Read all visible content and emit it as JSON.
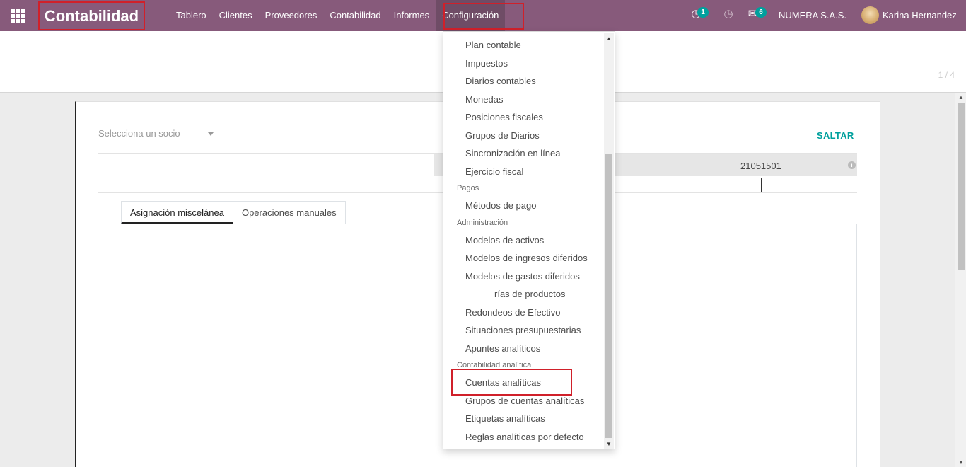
{
  "navbar": {
    "app_title": "Contabilidad",
    "menu": [
      "Tablero",
      "Clientes",
      "Proveedores",
      "Contabilidad",
      "Informes",
      "Configuración"
    ],
    "activity_count": "1",
    "messages_count": "6",
    "company": "NUMERA S.A.S.",
    "user": "Karina Hernandez",
    "colors": {
      "bar": "#875a7b",
      "active": "#6f4c66",
      "badge": "#00a09d",
      "highlight": "#d0202a"
    }
  },
  "control_panel": {
    "pager": "1 / 4"
  },
  "form": {
    "partner_placeholder": "Selecciona un socio",
    "skip_label": "SALTAR",
    "account_number": "21051501",
    "tabs": [
      "Asignación miscelánea",
      "Operaciones manuales"
    ]
  },
  "dropdown": {
    "items_top": [
      "Plan contable",
      "Impuestos",
      "Diarios contables",
      "Monedas",
      "Posiciones fiscales",
      "Grupos de Diarios",
      "Sincronización en línea",
      "Ejercicio fiscal"
    ],
    "header_pagos": "Pagos",
    "items_pagos": [
      "Métodos de pago"
    ],
    "header_admin": "Administración",
    "items_admin": [
      "Modelos de activos",
      "Modelos de ingresos diferidos",
      "Modelos de gastos diferidos",
      "rías de productos",
      "Redondeos de Efectivo",
      "Situaciones presupuestarias",
      "Apuntes analíticos"
    ],
    "header_analytic": "Contabilidad analítica",
    "items_analytic": [
      "Cuentas analíticas",
      "Grupos de cuentas analíticas",
      "Etiquetas analíticas",
      "Reglas analíticas por defecto"
    ]
  }
}
